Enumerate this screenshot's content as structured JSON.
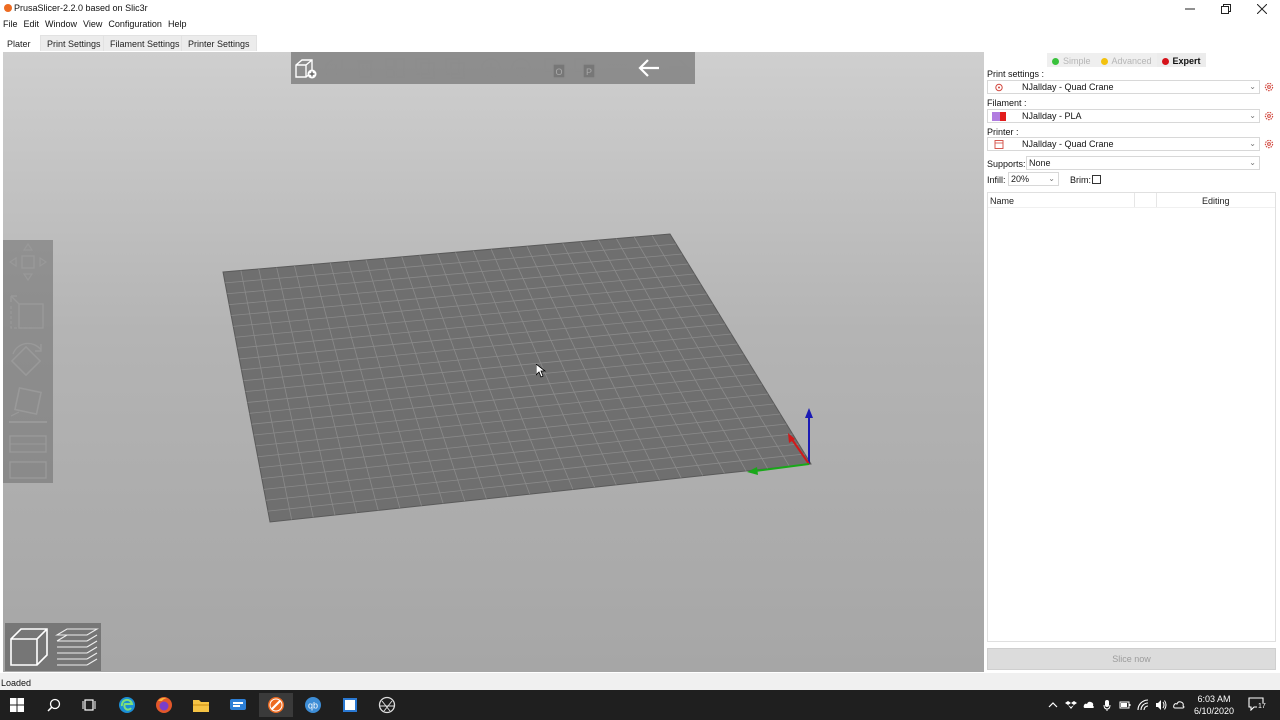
{
  "window": {
    "title": "PrusaSlicer-2.2.0 based on Slic3r",
    "minimize_icon": "minimize-icon",
    "maximize_icon": "restore-icon",
    "close_icon": "close-icon"
  },
  "menu": {
    "items": [
      "File",
      "Edit",
      "Window",
      "View",
      "Configuration",
      "Help"
    ]
  },
  "tabs": [
    {
      "label": "Plater",
      "active": true
    },
    {
      "label": "Print Settings",
      "active": false
    },
    {
      "label": "Filament Settings",
      "active": false
    },
    {
      "label": "Printer Settings",
      "active": false
    }
  ],
  "toolbar": {
    "buttons": [
      "add-icon",
      "delete-icon",
      "delete-all-icon",
      "arrange-icon",
      "copy-icon",
      "paste-icon",
      "add-instance-icon",
      "remove-instance-icon",
      "split-objects-icon",
      "split-parts-icon",
      "layers-editing-icon",
      "undo-icon",
      "redo-icon"
    ]
  },
  "gizmos": {
    "buttons": [
      "move-icon",
      "scale-icon",
      "rotate-icon",
      "place-on-face-icon",
      "cut-icon",
      "sla-support-icon"
    ]
  },
  "view_toggle": [
    "3d-view-icon",
    "preview-icon"
  ],
  "sidebar": {
    "modes": [
      {
        "label": "Simple",
        "color": "#39c23c",
        "active": false
      },
      {
        "label": "Advanced",
        "color": "#f3c20f",
        "active": false
      },
      {
        "label": "Expert",
        "color": "#d6131b",
        "active": true
      }
    ],
    "print_settings_label": "Print settings :",
    "print_settings_value": "NJallday - Quad Crane",
    "filament_label": "Filament :",
    "filament_value": "NJallday - PLA",
    "filament_colors": [
      "#b17ce0",
      "#e21c1c"
    ],
    "printer_label": "Printer :",
    "printer_value": "NJallday - Quad Crane",
    "supports_label": "Supports:",
    "supports_value": "None",
    "infill_label": "Infill:",
    "infill_value": "20%",
    "brim_label": "Brim:",
    "brim_checked": false,
    "object_list": {
      "columns": [
        "Name",
        "",
        "Editing"
      ]
    },
    "slice_label": "Slice now"
  },
  "status": {
    "text": "Loaded"
  },
  "taskbar": {
    "time": "6:03 AM",
    "date": "6/10/2020",
    "notification_count": "17"
  },
  "colors": {
    "accent_orange": "#ed6b21",
    "axis_x": "#d11a1a",
    "axis_y": "#19a819",
    "axis_z": "#1a1ab4"
  }
}
